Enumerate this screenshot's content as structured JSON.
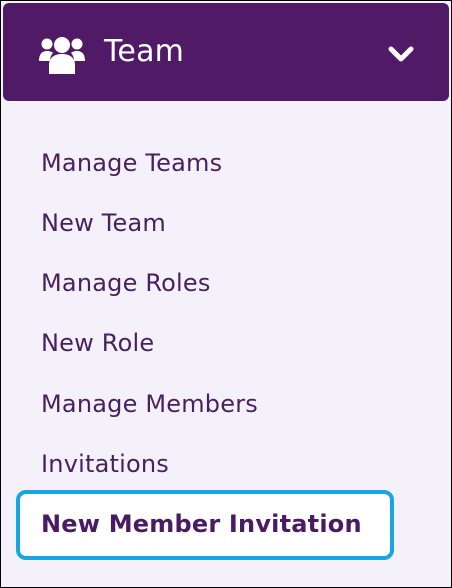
{
  "header": {
    "title": "Team",
    "icon": "team-icon",
    "toggle_icon": "chevron-down-icon",
    "background": "#511a67"
  },
  "menu": {
    "items": [
      {
        "label": "Manage Teams"
      },
      {
        "label": "New Team"
      },
      {
        "label": "Manage Roles"
      },
      {
        "label": "New Role"
      },
      {
        "label": "Manage Members"
      },
      {
        "label": "Invitations"
      },
      {
        "label": "New Member Invitation",
        "active": true
      }
    ],
    "text_color": "#4a2160",
    "highlight_color": "#17a6e0"
  }
}
